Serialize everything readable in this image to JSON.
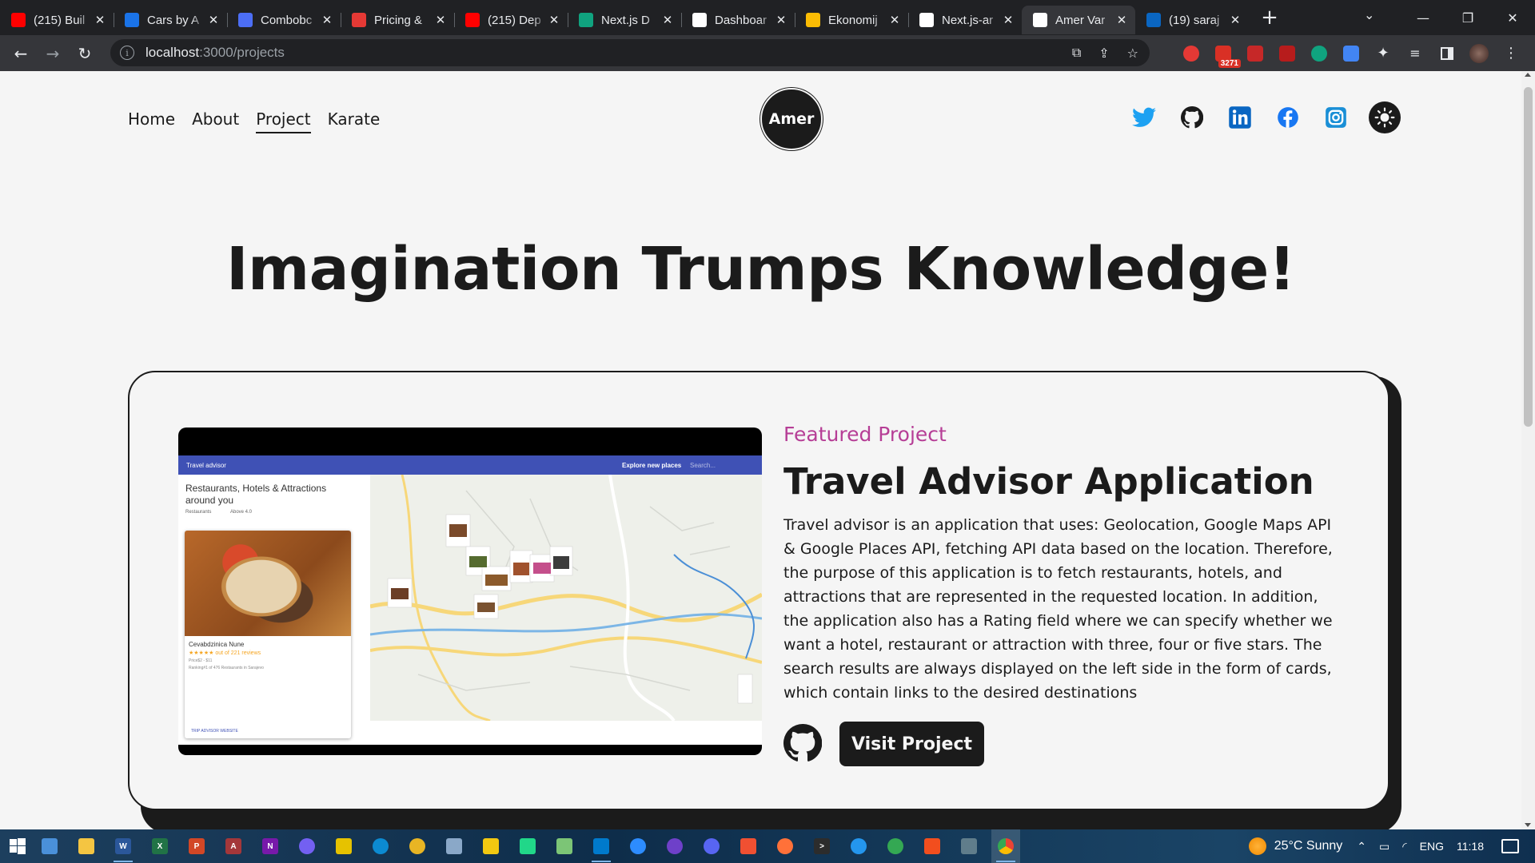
{
  "browser": {
    "tabs": [
      {
        "title": "(215) Buil",
        "icon": "youtube-icon",
        "color": "#ff0000"
      },
      {
        "title": "Cars by A",
        "icon": "search-icon",
        "color": "#1a73e8"
      },
      {
        "title": "Combobc",
        "icon": "combobox-icon",
        "color": "#4c6ef5"
      },
      {
        "title": "Pricing &",
        "icon": "pricing-icon",
        "color": "#e53935"
      },
      {
        "title": "(215) Dep",
        "icon": "youtube-icon",
        "color": "#ff0000"
      },
      {
        "title": "Next.js D",
        "icon": "openai-icon",
        "color": "#10a37f"
      },
      {
        "title": "Dashboar",
        "icon": "vercel-icon",
        "color": "#ffffff"
      },
      {
        "title": "Ekonomij",
        "icon": "shield-icon",
        "color": "#fbbc04"
      },
      {
        "title": "Next.js-ar",
        "icon": "github-icon",
        "color": "#ffffff"
      },
      {
        "title": "Amer Var",
        "icon": "vercel-icon",
        "color": "#ffffff"
      },
      {
        "title": "(19) saraj",
        "icon": "linkedin-icon",
        "color": "#0a66c2"
      }
    ],
    "active_tab_index": 9,
    "url_host": "localhost",
    "url_rest": ":3000/projects",
    "extension_badge": "3271"
  },
  "site": {
    "nav": [
      "Home",
      "About",
      "Project",
      "Karate"
    ],
    "current_nav": "Project",
    "logo_text": "Amer",
    "socials": [
      "twitter-icon",
      "github-icon",
      "linkedin-icon",
      "facebook-icon",
      "instagram-icon"
    ],
    "hero_title": "Imagination Trumps Knowledge!",
    "project": {
      "kicker": "Featured Project",
      "title": "Travel Advisor Application",
      "description": "Travel advisor is an application that uses: Geolocation, Google Maps API & Google Places API, fetching API data based on the location. Therefore, the purpose of this application is to fetch restaurants, hotels, and attractions that are represented in the requested location. In addition, the application also has a Rating field where we can specify whether we want a hotel, restaurant or attraction with three, four or five stars. The search results are always displayed on the left side in the form of cards, which contain links to the desired destinations",
      "visit_label": "Visit Project",
      "screenshot": {
        "app_title": "Travel advisor",
        "explore": "Explore new places",
        "search": "Search...",
        "side_title": "Restaurants, Hotels & Attractions around you",
        "filter_type": "Restaurants",
        "filter_rating": "Above 4.0",
        "place_name": "Cevabdzinica Nune",
        "place_stars": "★★★★★ out of 221 reviews",
        "place_price": "Price$2 - $11",
        "place_rank": "Ranking#1 of 476 Restaurants in Sarajevo",
        "place_tags": "TRIP ADVISOR    WEBSITE"
      }
    }
  },
  "taskbar": {
    "weather": "25°C  Sunny",
    "language": "ENG",
    "time": "11:18"
  },
  "colors": {
    "dark": "#1b1b1b",
    "light": "#f5f5f5",
    "accent": "#b63e96"
  }
}
